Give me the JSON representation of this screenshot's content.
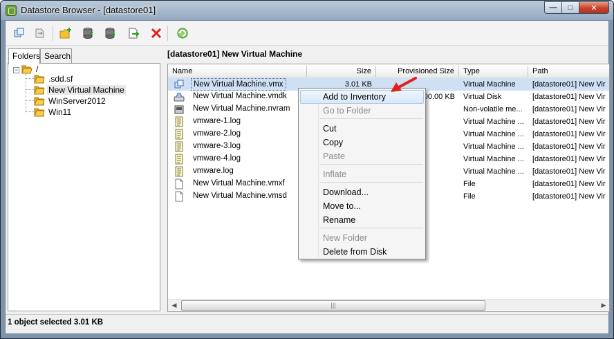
{
  "window": {
    "title": "Datastore Browser - [datastore01]",
    "controls": {
      "minimize": "—",
      "maximize": "□",
      "close": "✕"
    }
  },
  "toolbar": {
    "buttons": [
      {
        "name": "datastore-browser-icon"
      },
      {
        "name": "move-icon"
      },
      {
        "name": "new-folder-icon"
      },
      {
        "name": "upload-icon"
      },
      {
        "name": "download-icon"
      },
      {
        "name": "move-to-icon"
      },
      {
        "name": "delete-icon"
      },
      {
        "name": "refresh-icon"
      }
    ]
  },
  "tabs": {
    "folders": "Folders",
    "search": "Search"
  },
  "tree": {
    "root": {
      "label": "/",
      "toggle": "−"
    },
    "children": [
      {
        "label": ".sdd.sf"
      },
      {
        "label": "New Virtual Machine"
      },
      {
        "label": "WinServer2012"
      },
      {
        "label": "Win11"
      }
    ]
  },
  "path_label": "[datastore01] New Virtual Machine",
  "file_list": {
    "headers": {
      "name": "Name",
      "size": "Size",
      "provisioned": "Provisioned Size",
      "type": "Type",
      "path": "Path"
    },
    "rows": [
      {
        "icon": "vm-icon",
        "name": "New Virtual Machine.vmx",
        "size": "3.01 KB",
        "provisioned": "",
        "type": "Virtual Machine",
        "path": "[datastore01] New Vir"
      },
      {
        "icon": "disk-icon",
        "name": "New Virtual Machine.vmdk",
        "size": "",
        "provisioned": "00.00 KB",
        "type": "Virtual Disk",
        "path": "[datastore01] New Vir"
      },
      {
        "icon": "nvram-icon",
        "name": "New Virtual Machine.nvram",
        "size": "",
        "provisioned": "",
        "type": "Non-volatile me...",
        "path": "[datastore01] New Vir"
      },
      {
        "icon": "log-icon",
        "name": "vmware-1.log",
        "size": "",
        "provisioned": "",
        "type": "Virtual Machine ...",
        "path": "[datastore01] New Vir"
      },
      {
        "icon": "log-icon",
        "name": "vmware-2.log",
        "size": "",
        "provisioned": "",
        "type": "Virtual Machine ...",
        "path": "[datastore01] New Vir"
      },
      {
        "icon": "log-icon",
        "name": "vmware-3.log",
        "size": "",
        "provisioned": "",
        "type": "Virtual Machine ...",
        "path": "[datastore01] New Vir"
      },
      {
        "icon": "log-icon",
        "name": "vmware-4.log",
        "size": "",
        "provisioned": "",
        "type": "Virtual Machine ...",
        "path": "[datastore01] New Vir"
      },
      {
        "icon": "log-icon",
        "name": "vmware.log",
        "size": "",
        "provisioned": "",
        "type": "Virtual Machine ...",
        "path": "[datastore01] New Vir"
      },
      {
        "icon": "file-icon",
        "name": "New Virtual Machine.vmxf",
        "size": "",
        "provisioned": "",
        "type": "File",
        "path": "[datastore01] New Vir"
      },
      {
        "icon": "file-icon",
        "name": "New Virtual Machine.vmsd",
        "size": "",
        "provisioned": "",
        "type": "File",
        "path": "[datastore01] New Vir"
      }
    ],
    "scroll_left": "◀",
    "scroll_right": "▶",
    "scroll_grip": "|||"
  },
  "context_menu": {
    "items": [
      {
        "label": "Add to Inventory",
        "state": "highlight"
      },
      {
        "label": "Go to Folder",
        "state": "disabled"
      },
      {
        "label": "Cut",
        "state": "enabled"
      },
      {
        "label": "Copy",
        "state": "enabled"
      },
      {
        "label": "Paste",
        "state": "disabled"
      },
      {
        "label": "Inflate",
        "state": "disabled"
      },
      {
        "label": "Download...",
        "state": "enabled"
      },
      {
        "label": "Move to...",
        "state": "enabled"
      },
      {
        "label": "Rename",
        "state": "enabled"
      },
      {
        "label": "New Folder",
        "state": "disabled"
      },
      {
        "label": "Delete from Disk",
        "state": "enabled"
      }
    ]
  },
  "status": {
    "text": "1 object selected 3.01 KB"
  },
  "colors": {
    "selection": "#cfe0f5",
    "menu_highlight": "#d9e8f8",
    "annotation_arrow": "#e02020",
    "folder": "#f2b824"
  }
}
